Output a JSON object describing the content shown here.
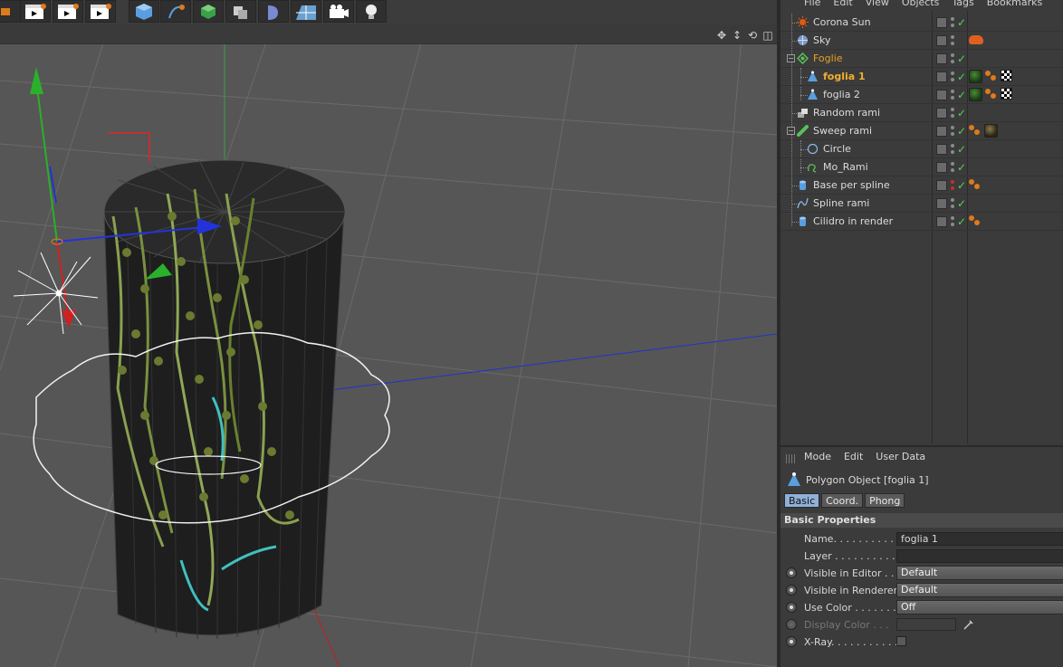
{
  "object_manager": {
    "menu": [
      "File",
      "Edit",
      "View",
      "Objects",
      "Tags",
      "Bookmarks"
    ],
    "objects": [
      {
        "name": "Corona Sun",
        "icon": "sun-icon",
        "tags": [],
        "check": true
      },
      {
        "name": "Sky",
        "icon": "sky-icon",
        "tags": [
          "sky-tag"
        ],
        "check": false
      },
      {
        "name": "Foglie",
        "icon": "cloner-icon",
        "tags": [],
        "check": true,
        "state": "parent-active"
      },
      {
        "name": "foglia 1",
        "icon": "polygon-icon",
        "tags": [
          "material-tag",
          "texture-tag",
          "checker-tag"
        ],
        "check": true,
        "state": "active"
      },
      {
        "name": "foglia 2",
        "icon": "polygon-icon",
        "tags": [
          "material-tag",
          "texture-tag",
          "checker-tag"
        ],
        "check": true
      },
      {
        "name": "Random rami",
        "icon": "random-effector-icon",
        "tags": [],
        "check": true
      },
      {
        "name": "Sweep rami",
        "icon": "sweep-icon",
        "tags": [
          "texture-tag",
          "material-tag"
        ],
        "check": true
      },
      {
        "name": "Circle",
        "icon": "circle-spline-icon",
        "tags": [],
        "check": true
      },
      {
        "name": "Mo_Rami",
        "icon": "mospline-icon",
        "tags": [],
        "check": true
      },
      {
        "name": "Base per spline",
        "icon": "cylinder-icon",
        "tags": [
          "texture-tag"
        ],
        "check": true
      },
      {
        "name": "Spline rami",
        "icon": "spline-icon",
        "tags": [],
        "check": true
      },
      {
        "name": "Cilidro in render",
        "icon": "cylinder-icon",
        "tags": [
          "texture-tag"
        ],
        "check": true
      }
    ]
  },
  "attribute_manager": {
    "menu": [
      "Mode",
      "Edit",
      "User Data"
    ],
    "title": "Polygon Object [foglia 1]",
    "tabs": [
      "Basic",
      "Coord.",
      "Phong"
    ],
    "active_tab": "Basic",
    "section": "Basic Properties",
    "fields": {
      "name_label": "Name. . . . . . . . . . . .",
      "name_value": "foglia 1",
      "layer_label": "Layer . . . . . . . . . . . .",
      "layer_value": "",
      "vis_editor_label": "Visible in Editor . . .",
      "vis_editor_value": "Default",
      "vis_renderer_label": "Visible in Renderer",
      "vis_renderer_value": "Default",
      "use_color_label": "Use Color . . . . . . . .",
      "use_color_value": "Off",
      "display_color_label": "Display Color . . .",
      "xray_label": "X-Ray. . . . . . . . . . . ."
    }
  },
  "colors": {
    "accent": "#8fb0d8",
    "active_object": "#f0b030",
    "check": "#58d058"
  }
}
